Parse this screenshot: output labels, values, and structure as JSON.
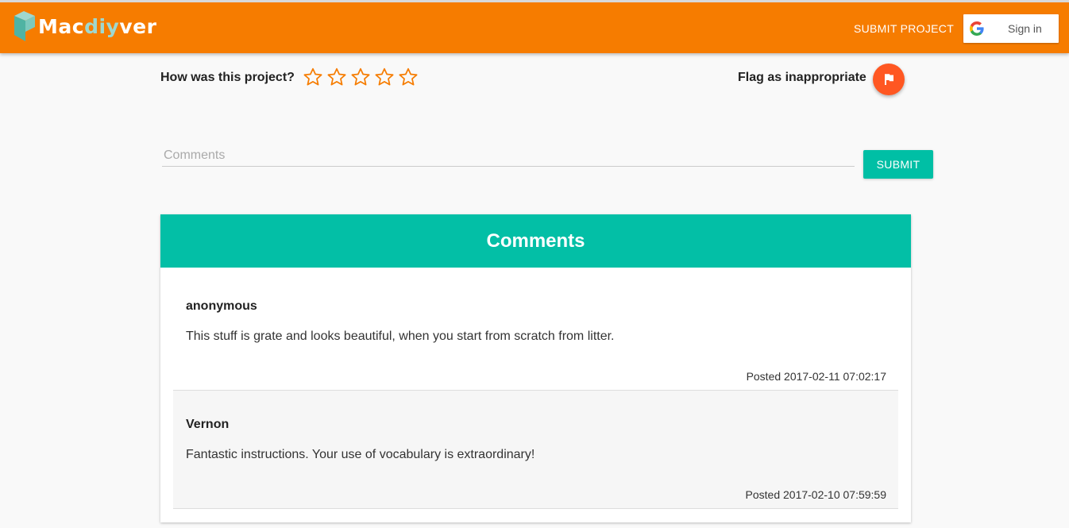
{
  "header": {
    "logo_prefix": "Mac",
    "logo_highlight": "diy",
    "logo_suffix": "ver",
    "submit_project_label": "SUBMIT PROJECT",
    "signin_label": "Sign in"
  },
  "rating": {
    "label": "How was this project?",
    "stars": 5,
    "value": 0
  },
  "flag": {
    "label": "Flag as inappropriate"
  },
  "comment_form": {
    "placeholder": "Comments",
    "value": "",
    "submit_label": "SUBMIT"
  },
  "comments": {
    "title": "Comments",
    "items": [
      {
        "author": "anonymous",
        "text": "This stuff is grate and looks beautiful, when you start from scratch from litter.",
        "posted": "Posted 2017-02-11 07:02:17"
      },
      {
        "author": "Vernon",
        "text": "Fantastic instructions. Your use of vocabulary is extraordinary!",
        "posted": "Posted 2017-02-10 07:59:59"
      }
    ]
  },
  "colors": {
    "header_bg": "#f67c00",
    "accent_teal": "#00bfa5",
    "flag_orange": "#ff5722",
    "star_orange": "#f67c00"
  },
  "icons": {
    "logo": "cube-logo-icon",
    "google": "google-icon",
    "star": "star-outline-icon",
    "flag": "flag-icon"
  }
}
